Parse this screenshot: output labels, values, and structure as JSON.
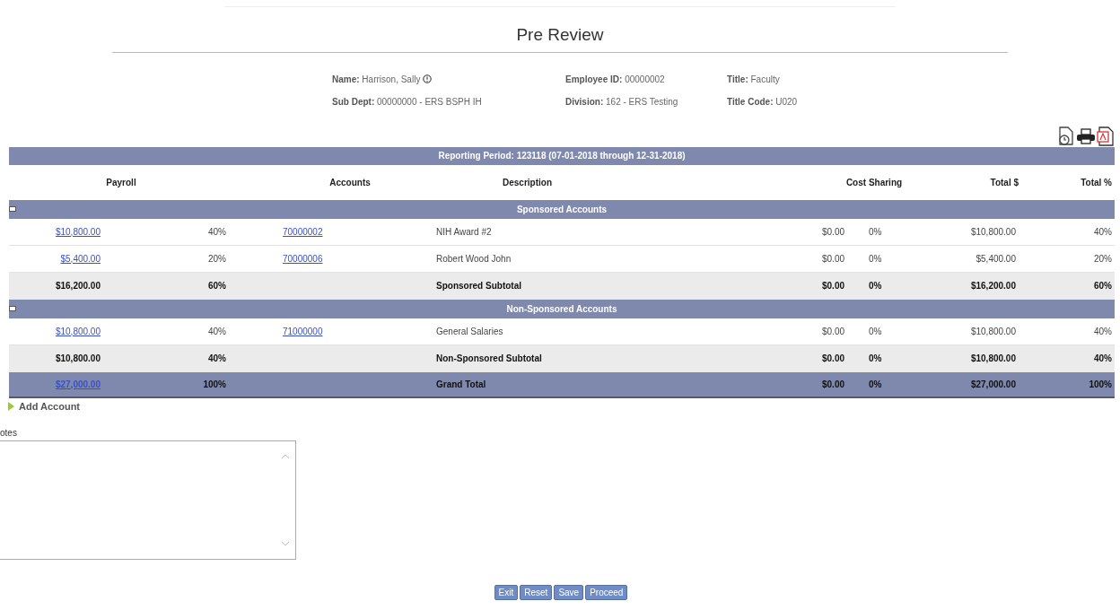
{
  "title": "Pre Review",
  "employee": [
    {
      "label": "Name:",
      "value": "Harrison, Sally",
      "info": true
    },
    {
      "label": "Employee ID:",
      "value": "00000002",
      "info": false
    },
    {
      "label": "Title:",
      "value": "Faculty",
      "info": false
    },
    {
      "label": "Sub Dept:",
      "value": "00000000 - ERS BSPH IH",
      "info": false
    },
    {
      "label": "Division:",
      "value": "162 - ERS Testing",
      "info": false
    },
    {
      "label": "Title Code:",
      "value": "U020",
      "info": false
    }
  ],
  "table": {
    "period": "Reporting Period: 123118 (07-01-2018 through 12-31-2018)",
    "columns": [
      "Payroll",
      "Accounts",
      "Description",
      "Cost Sharing",
      "Total $",
      "Total %"
    ],
    "sections": [
      {
        "title": "Sponsored Accounts",
        "expanded": true,
        "rows": [
          {
            "payroll": "$10,800.00",
            "payroll_pct": "40%",
            "account": "70000002",
            "description": "NIH Award #2",
            "cost": "$0.00",
            "cost_pct": "0%",
            "total": "$10,800.00",
            "total_pct": "40%"
          },
          {
            "payroll": "$5,400.00",
            "payroll_pct": "20%",
            "account": "70000006",
            "description": "Robert Wood John",
            "cost": "$0.00",
            "cost_pct": "0%",
            "total": "$5,400.00",
            "total_pct": "20%"
          }
        ],
        "subtotal": {
          "payroll": "$16,200.00",
          "payroll_pct": "60%",
          "description": "Sponsored Subtotal",
          "cost": "$0.00",
          "cost_pct": "0%",
          "total": "$16,200.00",
          "total_pct": "60%"
        }
      },
      {
        "title": "Non-Sponsored Accounts",
        "expanded": true,
        "rows": [
          {
            "payroll": "$10,800.00",
            "payroll_pct": "40%",
            "account": "71000000",
            "description": "General Salaries",
            "cost": "$0.00",
            "cost_pct": "0%",
            "total": "$10,800.00",
            "total_pct": "40%"
          }
        ],
        "subtotal": {
          "payroll": "$10,800.00",
          "payroll_pct": "40%",
          "description": "Non-Sponsored Subtotal",
          "cost": "$0.00",
          "cost_pct": "0%",
          "total": "$10,800.00",
          "total_pct": "40%"
        }
      }
    ],
    "grand_total": {
      "payroll": "$27,000.00",
      "payroll_pct": "100%",
      "description": "Grand Total",
      "cost": "$0.00",
      "cost_pct": "0%",
      "total": "$27,000.00",
      "total_pct": "100%"
    }
  },
  "add_account": "Add Account",
  "notes_label": "otes",
  "buttons": [
    "Exit",
    "Reset",
    "Save",
    "Proceed"
  ]
}
